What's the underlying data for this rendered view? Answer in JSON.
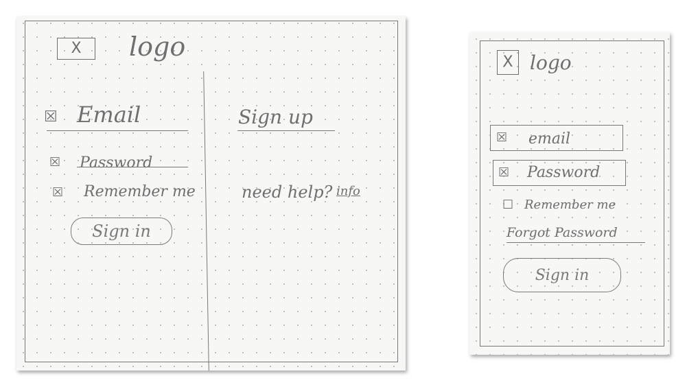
{
  "desktop": {
    "logo_mark": "X",
    "logo_text": "logo",
    "email_label": "Email",
    "email_mark": "☒",
    "password_label": "Password",
    "password_mark": "☒",
    "remember_label": "Remember me",
    "remember_mark": "☒",
    "signin_label": "Sign in",
    "signup_label": "Sign up",
    "help_text": "need help?",
    "help_link": "info"
  },
  "mobile": {
    "logo_mark": "X",
    "logo_text": "logo",
    "email_label": "email",
    "email_mark": "☒",
    "password_label": "Password",
    "password_mark": "☒",
    "remember_label": "Remember me",
    "remember_mark": "☐",
    "forgot_label": "Forgot Password",
    "signin_label": "Sign in"
  }
}
